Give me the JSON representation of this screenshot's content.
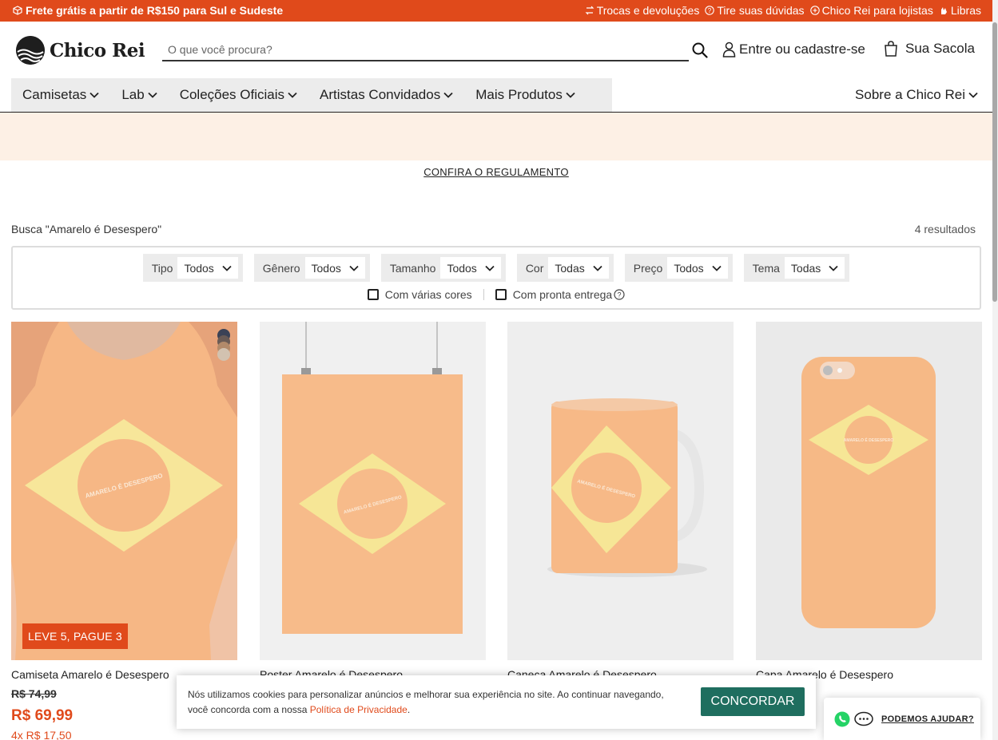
{
  "topbar": {
    "promo": "Frete grátis a partir de R$150 para Sul e Sudeste",
    "links": [
      {
        "label": "Trocas e devoluções",
        "icon": "exchange-icon"
      },
      {
        "label": "Tire suas dúvidas",
        "icon": "help-circle-icon"
      },
      {
        "label": "Chico Rei para lojistas",
        "icon": "store-icon"
      },
      {
        "label": "Libras",
        "icon": "sign-language-icon"
      }
    ],
    "bg_color": "#e04a1b"
  },
  "header": {
    "logo_text": "Chico Rei",
    "search_placeholder": "O que você procura?",
    "account_label": "Entre ou cadastre-se",
    "bag_label": "Sua Sacola"
  },
  "nav": {
    "items": [
      "Camisetas",
      "Lab",
      "Coleções Oficiais",
      "Artistas Convidados",
      "Mais Produtos"
    ],
    "right_item": "Sobre a Chico Rei"
  },
  "banner": {
    "link": "CONFIRA O REGULAMENTO"
  },
  "results": {
    "title": "Busca \"Amarelo é Desespero\"",
    "count": "4 resultados"
  },
  "filters": [
    {
      "label": "Tipo",
      "value": "Todos"
    },
    {
      "label": "Gênero",
      "value": "Todos"
    },
    {
      "label": "Tamanho",
      "value": "Todos"
    },
    {
      "label": "Cor",
      "value": "Todas"
    },
    {
      "label": "Preço",
      "value": "Todos"
    },
    {
      "label": "Tema",
      "value": "Todas"
    }
  ],
  "checks": {
    "multi_color": "Com várias cores",
    "ready": "Com pronta entrega"
  },
  "products": [
    {
      "name": "Camiseta Amarelo é Desespero",
      "old_price": "R$ 74,99",
      "price": "R$ 69,99",
      "installments": "4x R$ 17,50",
      "badge": "LEVE 5, PAGUE 3"
    },
    {
      "name": "Poster Amarelo é Desespero"
    },
    {
      "name": "Caneca Amarelo é Desespero"
    },
    {
      "name": "Capa Amarelo é Desespero"
    }
  ],
  "product_art_text": "AMARELO É DESESPERO",
  "cookie": {
    "text_before": "Nós utilizamos cookies para personalizar anúncios e melhorar sua experiência no site. Ao continuar navegando, você concorda com a nossa ",
    "link": "Política de Privacidade",
    "text_after": ".",
    "button": "CONCORDAR",
    "button_color": "#1f6e5f"
  },
  "help": {
    "label": "PODEMOS AJUDAR?"
  }
}
